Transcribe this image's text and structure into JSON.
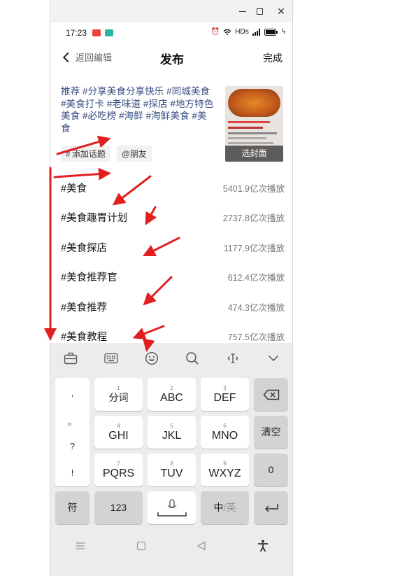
{
  "status_bar": {
    "time": "17:23",
    "network": "HDs"
  },
  "nav": {
    "back_label": "返回编辑",
    "title": "发布",
    "done_label": "完成"
  },
  "post": {
    "text": "推荐 #分享美食分享快乐 #同城美食 #美食打卡 #老味道 #探店 #地方特色美食 #必吃榜 #海鲜 #海鲜美食 #美食"
  },
  "cover": {
    "label": "选封面"
  },
  "chips": {
    "add_topic": "添加话题",
    "mention": "@朋友"
  },
  "topics": [
    {
      "name": "#美食",
      "count": "5401.9亿次播放"
    },
    {
      "name": "#美食趣胃计划",
      "count": "2737.8亿次播放"
    },
    {
      "name": "#美食探店",
      "count": "1177.9亿次播放"
    },
    {
      "name": "#美食推荐官",
      "count": "612.4亿次播放"
    },
    {
      "name": "#美食推荐",
      "count": "474.3亿次播放"
    },
    {
      "name": "#美食教程",
      "count": "757.5亿次播放"
    }
  ],
  "keyboard": {
    "punct": [
      ",",
      "。",
      "?",
      "!"
    ],
    "rows": [
      {
        "num": "1",
        "label": "分词"
      },
      {
        "num": "2",
        "label": "ABC"
      },
      {
        "num": "3",
        "label": "DEF"
      },
      {
        "num": "4",
        "label": "GHI"
      },
      {
        "num": "5",
        "label": "JKL"
      },
      {
        "num": "6",
        "label": "MNO"
      },
      {
        "num": "7",
        "label": "PQRS"
      },
      {
        "num": "8",
        "label": "TUV"
      },
      {
        "num": "9",
        "label": "WXYZ"
      }
    ],
    "clear_label": "清空",
    "zero_label": "0",
    "symbol_label": "符",
    "num_label": "123",
    "lang_label_cn": "中",
    "lang_label_en": "/英"
  },
  "colors": {
    "hashtag": "#3a4f86",
    "arrow": "#e02020"
  }
}
